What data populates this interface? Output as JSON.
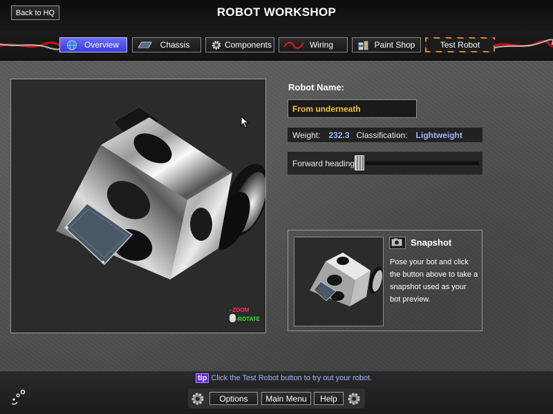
{
  "header": {
    "title": "ROBOT WORKSHOP",
    "back_label": "Back to HQ"
  },
  "tabs": [
    {
      "label": "Overview",
      "icon": "globe-icon",
      "active": true
    },
    {
      "label": "Chassis",
      "icon": "chassis-icon",
      "active": false
    },
    {
      "label": "Components",
      "icon": "gear-icon",
      "active": false
    },
    {
      "label": "Wiring",
      "icon": "wire-icon",
      "active": false
    },
    {
      "label": "Paint Shop",
      "icon": "paint-can-icon",
      "active": false
    },
    {
      "label": "Test Robot",
      "icon": "",
      "active": false
    }
  ],
  "viewport": {
    "hint_zoom": "ZOOM",
    "hint_rotate": "ROTATE"
  },
  "robot": {
    "name_label": "Robot Name:",
    "name_value": "From underneath",
    "weight_label": "Weight:",
    "weight_value": "232.3",
    "class_label": "Classification:",
    "class_value": "Lightweight",
    "heading_label": "Forward heading:",
    "heading_level": 0.0
  },
  "snapshot": {
    "title": "Snapshot",
    "description": "Pose your bot and click the button above to take a snapshot used as your bot preview."
  },
  "footer": {
    "tip_tag": "tip",
    "tip_text": "Click the Test Robot button to try out your robot.",
    "buttons": [
      "Options",
      "Main Menu",
      "Help"
    ]
  },
  "colors": {
    "active_tab": "#4c4cf0",
    "name_text": "#f6c23b",
    "stat_value": "#9cb8ff",
    "tip_tag": "#5e2bd4"
  }
}
